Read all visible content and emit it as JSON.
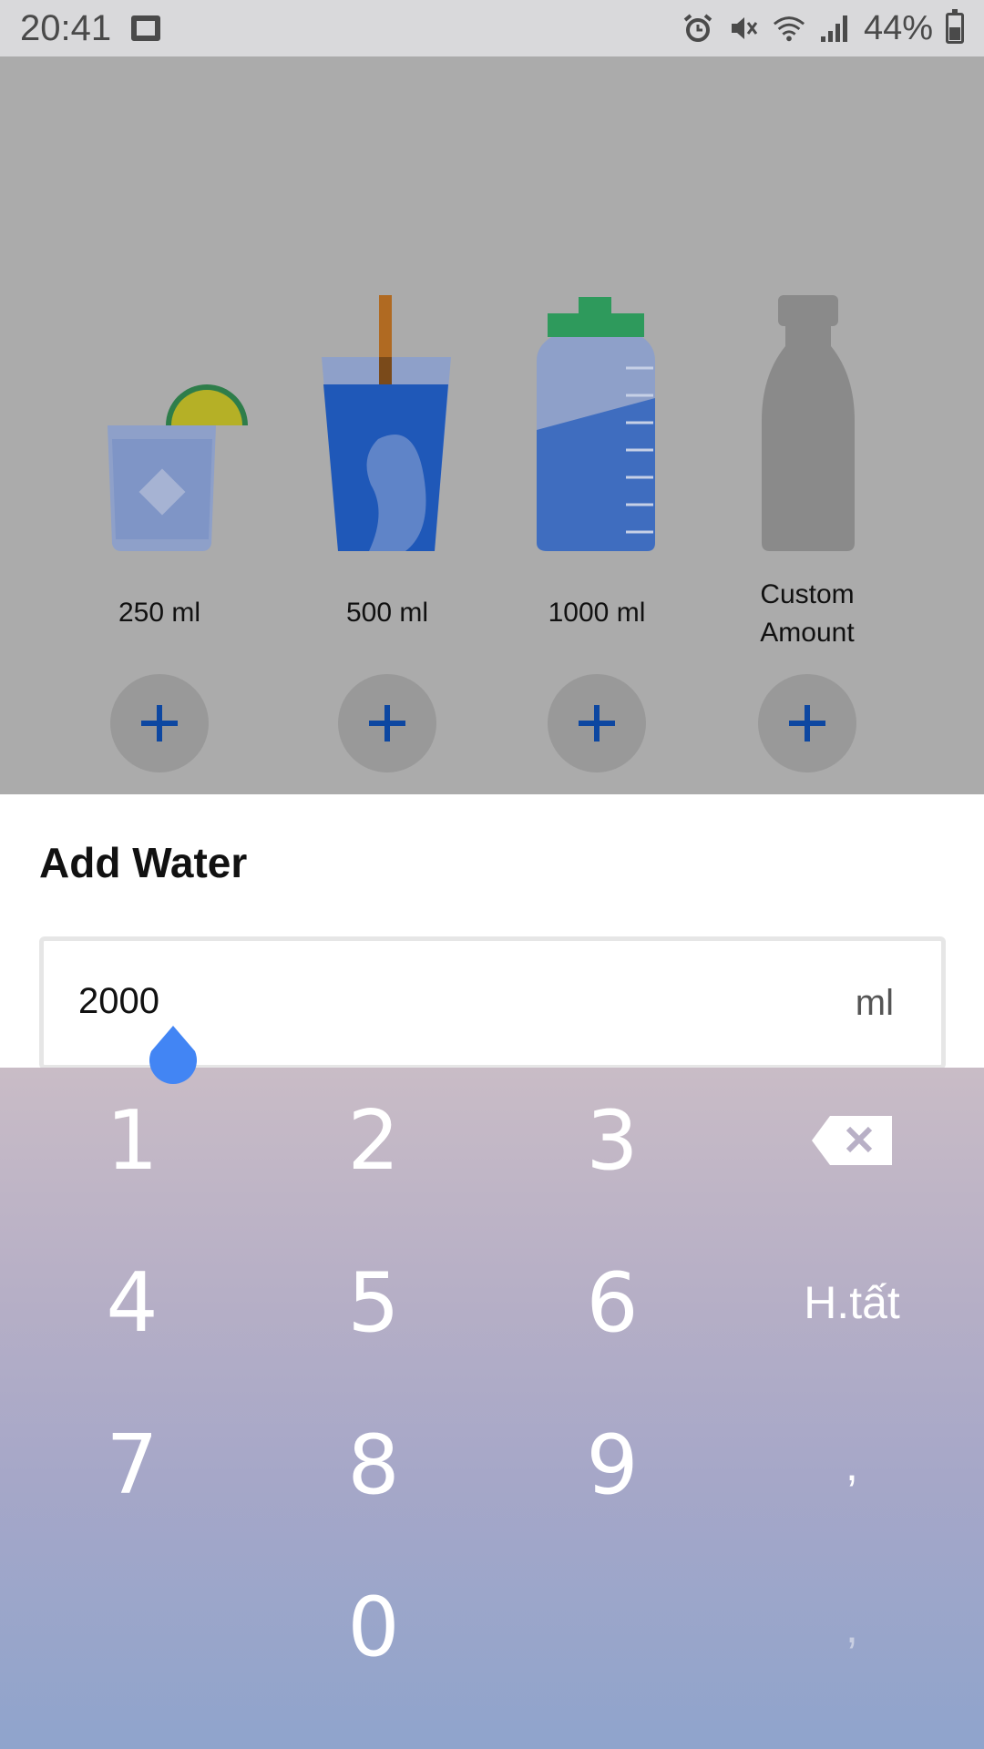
{
  "status_bar": {
    "time": "20:41",
    "battery": "44%",
    "icons": [
      "image-icon",
      "alarm-icon",
      "mute-icon",
      "wifi-icon",
      "signal-icon",
      "battery-icon"
    ]
  },
  "drinks": [
    {
      "label": "250 ml",
      "icon": "glass-with-lemon-icon"
    },
    {
      "label": "500 ml",
      "icon": "cup-with-straw-icon"
    },
    {
      "label": "1000 ml",
      "icon": "sport-bottle-icon"
    },
    {
      "label": "Custom Amount",
      "label_line1": "Custom",
      "label_line2": "Amount",
      "icon": "custom-bottle-icon"
    }
  ],
  "add_symbol": "+",
  "sheet": {
    "title": "Add Water",
    "amount_value": "2000",
    "amount_unit": "ml"
  },
  "keyboard": {
    "keys": [
      "1",
      "2",
      "3",
      "4",
      "5",
      "6",
      "7",
      "8",
      "9",
      "0"
    ],
    "done_label": "H.tất",
    "comma": ",",
    "comma2": ","
  },
  "colors": {
    "accent": "#0d47a1",
    "cursor": "#4285f4",
    "sheet_bg": "#ffffff",
    "overlay": "#ababab"
  }
}
